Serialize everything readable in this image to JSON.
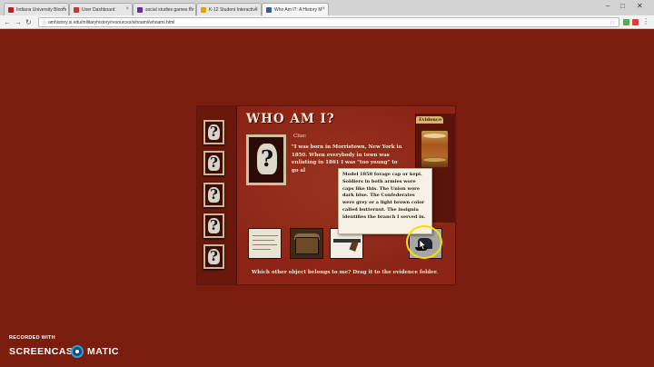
{
  "browser": {
    "tabs": [
      {
        "title": "Indiana University Bloom",
        "color": "#b22222"
      },
      {
        "title": "User Dashboard",
        "color": "#c0392b"
      },
      {
        "title": "social studies games for",
        "color": "#6a2ca0"
      },
      {
        "title": "K-12 Student Interactive",
        "color": "#e6a100"
      },
      {
        "title": "Who Am I?: A History M",
        "color": "#3b5998"
      }
    ],
    "url": "amhistory.si.edu/militaryhistory/resources/whoami/whoami.html"
  },
  "game": {
    "title": "WHO AM I?",
    "evidence_label": "Evidence",
    "clue_label": "Clue:",
    "clue_text": "\"I was born in Morristown, New York in 1850. When everybody in town was enlisting in 1861 I was \"too young\" to go al",
    "prompt": "Which other object belongs to me?  Drag it to the evidence folder.",
    "tooltip": "Model 1858 forage cap or kepi. Soldiers in both armies wore caps like this. The Union wore dark blue. The Confederates were grey or a light brown color called butternut. The insignia identifies the branch I served in."
  },
  "watermark": {
    "recorded_with": "RECORDED WITH",
    "brand_left": "SCREENCAST",
    "brand_right": "MATIC"
  }
}
